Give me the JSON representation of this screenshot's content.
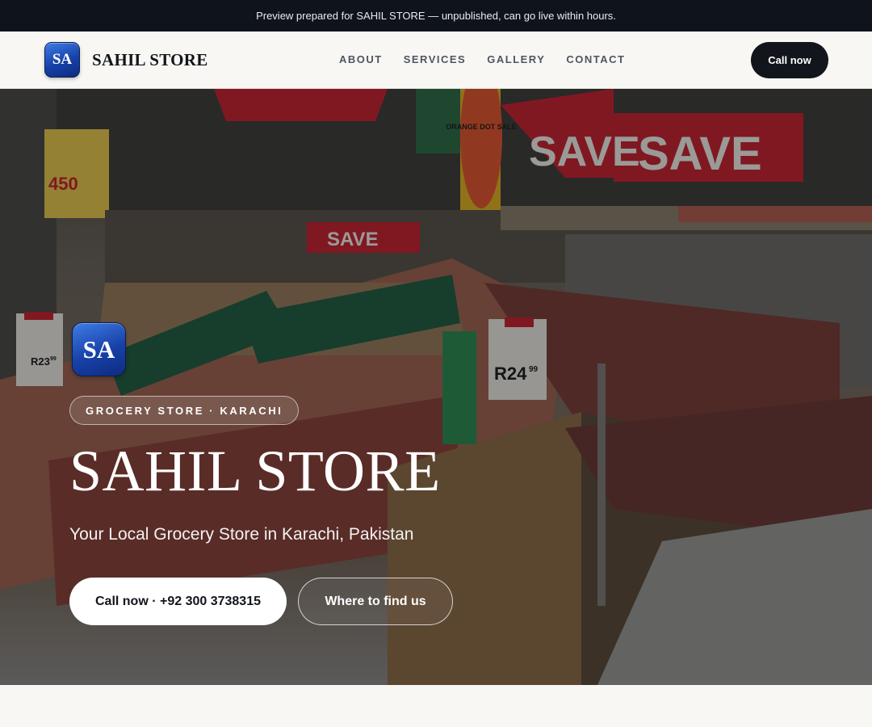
{
  "preview_banner": {
    "text": "Preview prepared for SAHIL STORE — unpublished, can go live within hours."
  },
  "header": {
    "logo_initials": "SA",
    "brand_name": "SAHIL STORE",
    "nav_links": [
      {
        "label": "ABOUT"
      },
      {
        "label": "SERVICES"
      },
      {
        "label": "GALLERY"
      },
      {
        "label": "CONTACT"
      }
    ],
    "cta_label": "Call now"
  },
  "hero": {
    "logo_initials": "SA",
    "category_chip": "GROCERY STORE · KARACHI",
    "title": "SAHIL STORE",
    "subtitle": "Your Local Grocery Store in Karachi, Pakistan",
    "primary_button": "Call now · +92 300 3738315",
    "secondary_button": "Where to find us",
    "background_image": {
      "icon": "grocery-store-photo",
      "signs": [
        "SAVE",
        "SAVE",
        "SAVE",
        "SAVE",
        "ORANGE DOT SALE",
        "R24",
        "99",
        "R23",
        "99",
        "450"
      ]
    }
  },
  "colors": {
    "banner_bg": "#0f131b",
    "page_bg": "#f8f7f3",
    "dark_button": "#12151c",
    "logo_blue": "#1741a8",
    "sale_red": "#c8202e"
  }
}
